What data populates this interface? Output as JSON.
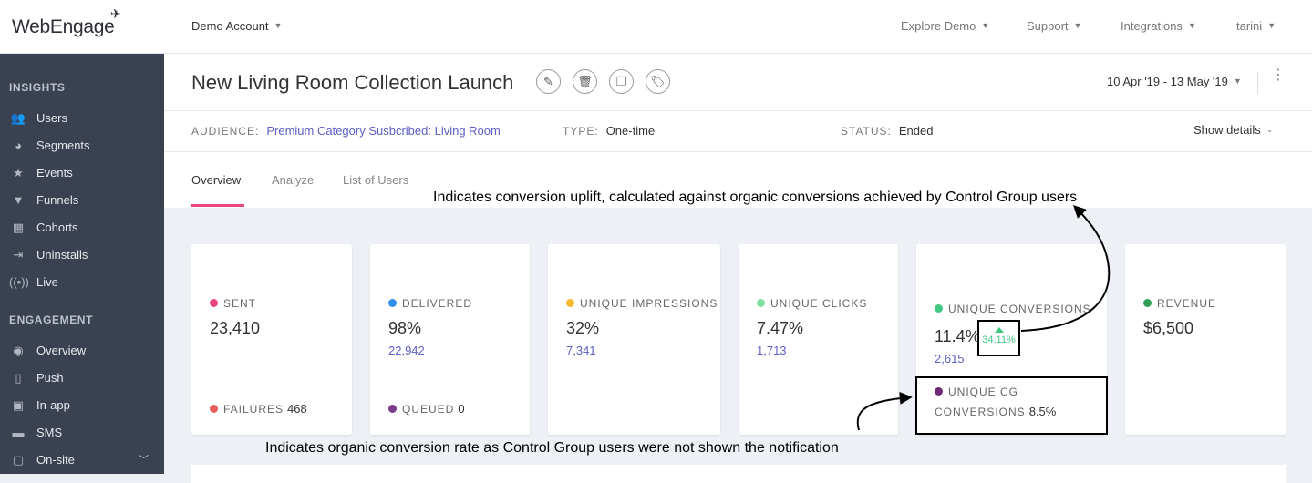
{
  "topbar": {
    "logo": "WebEngage",
    "account": "Demo Account",
    "nav": [
      "Explore Demo",
      "Support",
      "Integrations",
      "tarini"
    ]
  },
  "sidebar": {
    "sections": [
      {
        "title": "INSIGHTS",
        "items": [
          {
            "label": "Users",
            "icon": "users-icon"
          },
          {
            "label": "Segments",
            "icon": "pie-icon"
          },
          {
            "label": "Events",
            "icon": "star-icon"
          },
          {
            "label": "Funnels",
            "icon": "funnel-icon"
          },
          {
            "label": "Cohorts",
            "icon": "grid-icon"
          },
          {
            "label": "Uninstalls",
            "icon": "uninstall-icon"
          },
          {
            "label": "Live",
            "icon": "broadcast-icon"
          }
        ]
      },
      {
        "title": "ENGAGEMENT",
        "items": [
          {
            "label": "Overview",
            "icon": "eye-icon"
          },
          {
            "label": "Push",
            "icon": "push-icon"
          },
          {
            "label": "In-app",
            "icon": "inapp-icon"
          },
          {
            "label": "SMS",
            "icon": "sms-icon"
          },
          {
            "label": "On-site",
            "icon": "onsite-icon"
          }
        ]
      }
    ]
  },
  "campaign": {
    "title": "New Living Room Collection Launch",
    "actions": [
      "edit-icon",
      "delete-icon",
      "copy-icon",
      "tag-icon"
    ],
    "date_range": "10 Apr '19 - 13 May '19",
    "audience_label": "AUDIENCE:",
    "audience_value": "Premium Category Susbcribed: Living Room",
    "type_label": "TYPE:",
    "type_value": "One-time",
    "status_label": "STATUS:",
    "status_value": "Ended",
    "show_details": "Show details"
  },
  "tabs": [
    "Overview",
    "Analyze",
    "List of Users"
  ],
  "colors": {
    "sent": "#e8467c",
    "failures": "#e85c5c",
    "delivered": "#2f8fe8",
    "queued": "#7b3a8a",
    "impressions": "#f5b82e",
    "clicks": "#7de0a0",
    "conversions": "#3fc882",
    "cg": "#6b2a73",
    "revenue": "#2f9e57",
    "accent": "#e8467c",
    "link": "#5c5fc4"
  },
  "kpis": {
    "sent": {
      "label": "SENT",
      "value": "23,410"
    },
    "failures": {
      "label": "FAILURES",
      "value": "468"
    },
    "delivered": {
      "label": "DELIVERED",
      "value": "98%",
      "sub": "22,942"
    },
    "queued": {
      "label": "QUEUED",
      "value": "0"
    },
    "impressions": {
      "label": "UNIQUE IMPRESSIONS",
      "value": "32%",
      "sub": "7,341"
    },
    "clicks": {
      "label": "UNIQUE CLICKS",
      "value": "7.47%",
      "sub": "1,713"
    },
    "conversions": {
      "label": "UNIQUE CONVERSIONS",
      "value": "11.4%",
      "sub": "2,615",
      "uplift": "34.11%"
    },
    "cg": {
      "label_line1": "UNIQUE CG",
      "label_line2": "CONVERSIONS",
      "value": "8.5%"
    },
    "revenue": {
      "label": "REVENUE",
      "value": "$6,500"
    }
  },
  "annotations": {
    "uplift": "Indicates conversion uplift, calculated against organic conversions achieved by Control Group users",
    "cg": "Indicates organic conversion rate as Control Group users were not shown the notification"
  }
}
